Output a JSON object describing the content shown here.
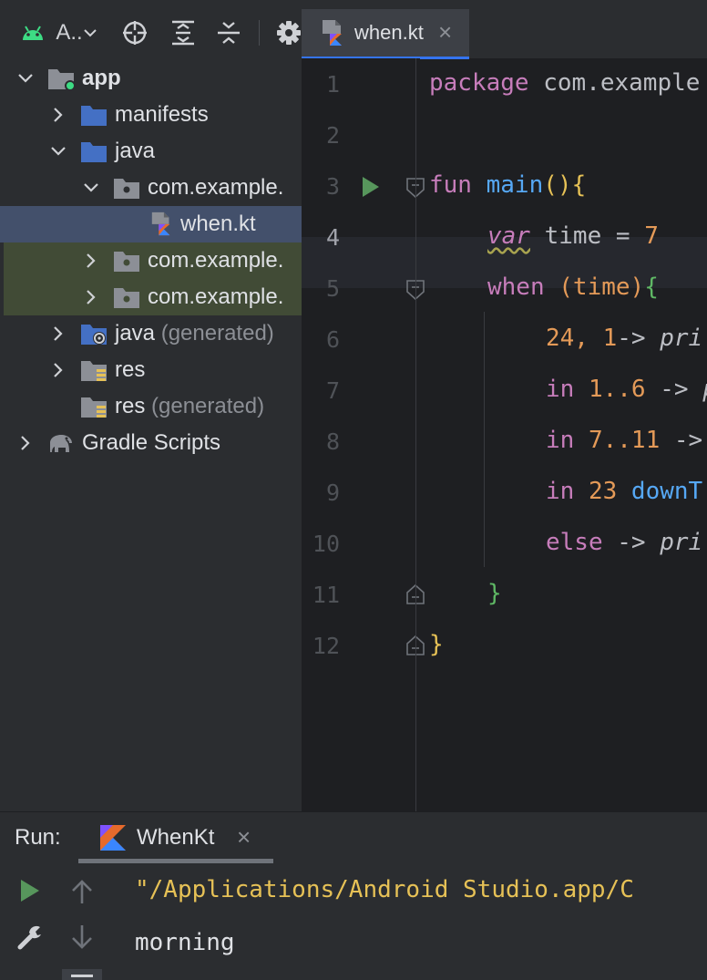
{
  "project_toolbar": {
    "view_label": "A..",
    "icons": [
      "android-icon",
      "chevron-down-icon",
      "locate-icon",
      "expand-all-icon",
      "collapse-all-icon",
      "gear-icon"
    ]
  },
  "tree": [
    {
      "label": "app",
      "icon": "module-folder-icon",
      "expanded": true
    },
    {
      "label": "manifests",
      "icon": "folder-icon",
      "expanded": false
    },
    {
      "label": "java",
      "icon": "source-folder-icon",
      "expanded": true
    },
    {
      "label": "com.example.",
      "icon": "package-icon",
      "expanded": true
    },
    {
      "label": "when.kt",
      "icon": "kotlin-file-icon",
      "selected": true
    },
    {
      "label": "com.example.",
      "icon": "package-icon",
      "expanded": false
    },
    {
      "label": "com.example.",
      "icon": "package-icon",
      "expanded": false
    },
    {
      "label": "java",
      "suffix": "(generated)",
      "icon": "generated-source-icon",
      "expanded": false
    },
    {
      "label": "res",
      "icon": "resources-folder-icon",
      "expanded": false
    },
    {
      "label": "res",
      "suffix": "(generated)",
      "icon": "resources-folder-icon"
    },
    {
      "label": "Gradle Scripts",
      "icon": "gradle-elephant-icon",
      "expanded": false
    }
  ],
  "editor": {
    "tab": {
      "label": "when.kt",
      "close": "×"
    },
    "line_numbers": [
      "1",
      "2",
      "3",
      "4",
      "5",
      "6",
      "7",
      "8",
      "9",
      "10",
      "11",
      "12"
    ],
    "code": {
      "l1_kw": "package",
      "l1_rest": " com.example",
      "l3_fun": "fun",
      "l3_name": "main",
      "l3_parens": "()",
      "l3_brace": "{",
      "l4_var": "var",
      "l4_rest": " time = ",
      "l4_num": "7",
      "l5_when": "when",
      "l5_paren": " (time)",
      "l5_brace": "{",
      "l6_nums": "24, 1",
      "l6_arrow": "-> ",
      "l6_fn": "pri",
      "l7_in": "in",
      "l7_range": " 1..6",
      "l7_arrow": " -> ",
      "l7_fn": "p",
      "l8_in": "in",
      "l8_range": " 7..11",
      "l8_arrow": " ->",
      "l9_in": "in",
      "l9_num": " 23",
      "l9_fn": " downT",
      "l10_else": "else",
      "l10_arrow": " -> ",
      "l10_fn": "pri",
      "l11_brace": "}",
      "l12_brace": "}"
    }
  },
  "run": {
    "label": "Run:",
    "tab_label": "WhenKt",
    "tab_close": "×",
    "output": [
      "\"/Applications/Android Studio.app/C",
      "morning"
    ]
  },
  "colors": {
    "accent": "#3574f0",
    "run_green": "#57965c",
    "selection": "#43506b",
    "highlight_rows": "#414b36"
  }
}
